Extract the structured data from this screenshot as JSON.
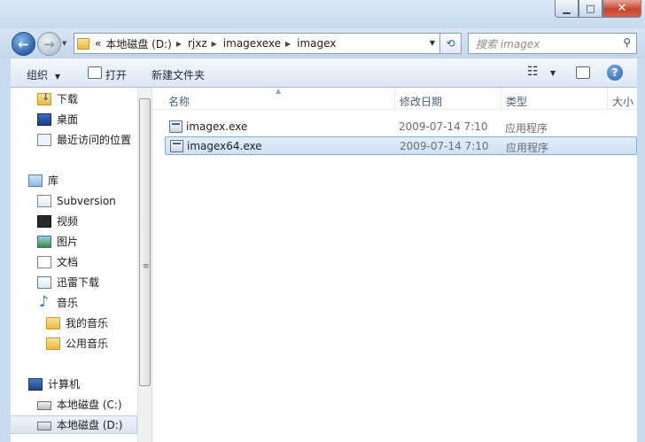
{
  "window": {
    "minimize_icon": "minimize-icon",
    "maximize_icon": "maximize-icon",
    "close_icon": "close-icon"
  },
  "address": {
    "overflow": "«",
    "crumbs": [
      "本地磁盘 (D:)",
      "rjxz",
      "imagexexe",
      "imagex"
    ],
    "search_placeholder": "搜索 imagex"
  },
  "toolbar": {
    "organize": "组织",
    "open": "打开",
    "new_folder": "新建文件夹"
  },
  "nav": {
    "favorites": [
      "下载",
      "桌面",
      "最近访问的位置"
    ],
    "libraries_label": "库",
    "libraries": [
      "Subversion",
      "视频",
      "图片",
      "文档",
      "迅雷下载",
      "音乐"
    ],
    "music_children": [
      "我的音乐",
      "公用音乐"
    ],
    "computer_label": "计算机",
    "drives": [
      "本地磁盘 (C:)",
      "本地磁盘 (D:)"
    ]
  },
  "columns": {
    "name": "名称",
    "date": "修改日期",
    "type": "类型",
    "size": "大小"
  },
  "files": [
    {
      "name": "imagex.exe",
      "date": "2009-07-14 7:10",
      "type": "应用程序",
      "selected": false
    },
    {
      "name": "imagex64.exe",
      "date": "2009-07-14 7:10",
      "type": "应用程序",
      "selected": true
    }
  ],
  "colors": {
    "chrome": "#c9dcef",
    "selection": "#cde1f5",
    "selection_border": "#84acdd"
  }
}
